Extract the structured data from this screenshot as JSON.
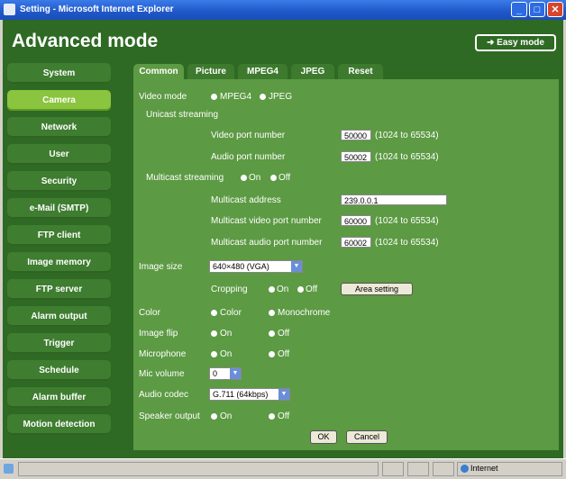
{
  "window": {
    "title": "Setting - Microsoft Internet Explorer",
    "controls": {
      "minimize": "_",
      "maximize": "□",
      "close": "✕"
    }
  },
  "header": {
    "title": "Advanced mode",
    "easy_mode_label": "➜ Easy mode"
  },
  "sidebar": {
    "items": [
      {
        "label": "System",
        "active": false
      },
      {
        "label": "Camera",
        "active": true
      },
      {
        "label": "Network",
        "active": false
      },
      {
        "label": "User",
        "active": false
      },
      {
        "label": "Security",
        "active": false
      },
      {
        "label": "e-Mail (SMTP)",
        "active": false
      },
      {
        "label": "FTP client",
        "active": false
      },
      {
        "label": "Image memory",
        "active": false
      },
      {
        "label": "FTP server",
        "active": false
      },
      {
        "label": "Alarm output",
        "active": false
      },
      {
        "label": "Trigger",
        "active": false
      },
      {
        "label": "Schedule",
        "active": false
      },
      {
        "label": "Alarm buffer",
        "active": false
      },
      {
        "label": "Motion detection",
        "active": false
      }
    ]
  },
  "tabs": [
    {
      "label": "Common",
      "active": true
    },
    {
      "label": "Picture",
      "active": false
    },
    {
      "label": "MPEG4",
      "active": false
    },
    {
      "label": "JPEG",
      "active": false
    },
    {
      "label": "Reset",
      "active": false
    }
  ],
  "form": {
    "video_mode": {
      "label": "Video mode",
      "options": [
        "MPEG4",
        "JPEG"
      ],
      "selected": "MPEG4"
    },
    "unicast_streaming": {
      "label": "Unicast streaming",
      "video_port": {
        "label": "Video port number",
        "value": "50000",
        "range": "(1024 to 65534)"
      },
      "audio_port": {
        "label": "Audio port number",
        "value": "50002",
        "range": "(1024 to 65534)"
      }
    },
    "multicast_streaming": {
      "label": "Multicast streaming",
      "options": [
        "On",
        "Off"
      ],
      "selected": "Off",
      "address": {
        "label": "Multicast address",
        "value": "239.0.0.1"
      },
      "video_port": {
        "label": "Multicast video port number",
        "value": "60000",
        "range": "(1024 to 65534)"
      },
      "audio_port": {
        "label": "Multicast audio port number",
        "value": "60002",
        "range": "(1024 to 65534)"
      }
    },
    "image_size": {
      "label": "Image size",
      "value": "640×480 (VGA)",
      "cropping": {
        "label": "Cropping",
        "options": [
          "On",
          "Off"
        ],
        "selected": "Off",
        "area_button": "Area setting"
      }
    },
    "color": {
      "label": "Color",
      "options": [
        "Color",
        "Monochrome"
      ],
      "selected": "Color"
    },
    "image_flip": {
      "label": "Image flip",
      "options": [
        "On",
        "Off"
      ],
      "selected": "On"
    },
    "microphone": {
      "label": "Microphone",
      "options": [
        "On",
        "Off"
      ],
      "selected": "On"
    },
    "mic_volume": {
      "label": "Mic volume",
      "value": "0"
    },
    "audio_codec": {
      "label": "Audio codec",
      "value": "G.711 (64kbps)"
    },
    "speaker_output": {
      "label": "Speaker output",
      "options": [
        "On",
        "Off"
      ],
      "selected": "Off"
    },
    "ok_label": "OK",
    "cancel_label": "Cancel"
  },
  "statusbar": {
    "zone": "Internet"
  }
}
